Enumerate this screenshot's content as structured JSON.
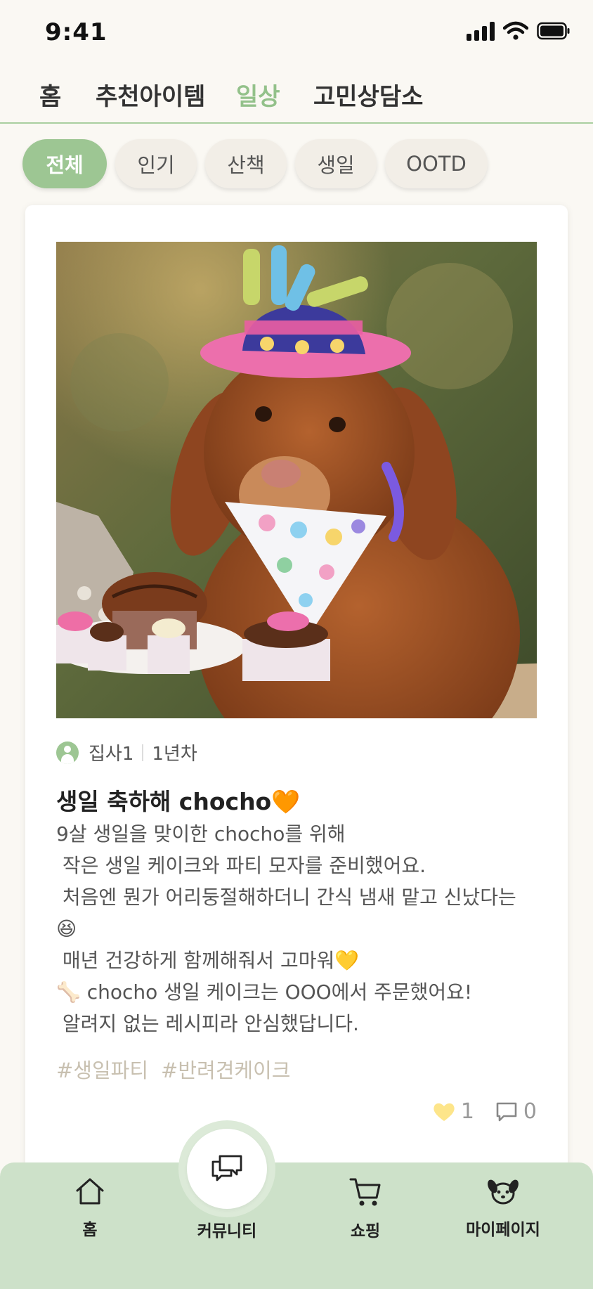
{
  "status_bar": {
    "time": "9:41"
  },
  "top_tabs": [
    {
      "label": "홈"
    },
    {
      "label": "추천아이템"
    },
    {
      "label": "일상",
      "active": true
    },
    {
      "label": "고민상담소"
    }
  ],
  "filters": [
    {
      "label": "전체",
      "active": true
    },
    {
      "label": "인기"
    },
    {
      "label": "산책"
    },
    {
      "label": "생일"
    },
    {
      "label": "OOTD"
    }
  ],
  "post": {
    "author": "집사1",
    "experience": "1년차",
    "title": "생일 축하해 chocho🧡",
    "body_lines": [
      "9살 생일을 맞이한 chocho를 위해",
      " 작은 생일 케이크와 파티 모자를 준비했어요.",
      " 처음엔 뭔가 어리둥절해하더니 간식 냄새 맡고 신났다는",
      "😆",
      " 매년 건강하게 함께해줘서 고마워💛",
      "🦴 chocho 생일 케이크는 OOO에서 주문했어요!",
      " 알려지 없는 레시피라 안심했답니다."
    ],
    "tags": [
      "#생일파티",
      "#반려견케이크"
    ],
    "likes": "1",
    "comments": "0"
  },
  "bottom_nav": [
    {
      "label": "홈",
      "icon": "home-icon"
    },
    {
      "label": "커뮤니티",
      "icon": "chat-icon",
      "active": true
    },
    {
      "label": "쇼핑",
      "icon": "cart-icon"
    },
    {
      "label": "마이페이지",
      "icon": "dog-face-icon"
    }
  ],
  "colors": {
    "accent": "#9dc693",
    "nav_bg": "#cde1c9",
    "page_bg": "#faf8f3",
    "heart": "#fde58a"
  }
}
